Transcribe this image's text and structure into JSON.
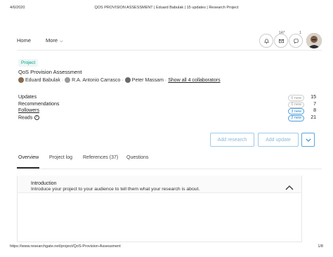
{
  "print_header": {
    "date": "4/6/2020",
    "title": "QOS PROVISION ASSESSMENT | Eduard Babulak | 15 updates | Research Project"
  },
  "nav": {
    "home": "Home",
    "more": "More",
    "counts": {
      "bell": "147",
      "chat": "1"
    }
  },
  "project": {
    "tag": "Project",
    "title": "QoS Provision Assessment",
    "collaborators": [
      {
        "name": "Eduard Babulak"
      },
      {
        "name": "R.A. Antonio Carrasco"
      },
      {
        "name": "Peter Massam"
      }
    ],
    "show_all": "Show all 4 collaborators"
  },
  "stats": [
    {
      "label": "Updates",
      "pill": "0 new",
      "pill_style": "grey",
      "value": "15",
      "link": false,
      "info": false
    },
    {
      "label": "Recommendations",
      "pill": "0 new",
      "pill_style": "grey",
      "value": "7",
      "link": false,
      "info": false
    },
    {
      "label": "Followers",
      "pill": "3 new",
      "pill_style": "blue",
      "value": "8",
      "link": true,
      "info": false
    },
    {
      "label": "Reads",
      "pill": "2 new",
      "pill_style": "blue",
      "value": "21",
      "link": false,
      "info": true
    }
  ],
  "actions": {
    "add_research": "Add research",
    "add_update": "Add update"
  },
  "tabs": [
    {
      "label": "Overview"
    },
    {
      "label": "Project log"
    },
    {
      "label": "References (37)"
    },
    {
      "label": "Questions"
    }
  ],
  "introduction": {
    "title": "Introduction",
    "text": "Introduce your project to your audience to tell them what your research is about."
  },
  "print_footer": {
    "url": "https://www.researchgate.net/project/QoS-Provision-Assessment",
    "page": "1/8"
  },
  "colors": {
    "accent": "#00a18a",
    "link_blue": "#2a86c8"
  }
}
